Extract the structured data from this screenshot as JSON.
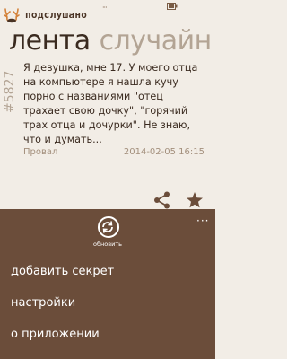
{
  "brand": {
    "logo_text": "подслушано",
    "icon": "antler-icon"
  },
  "pivot": {
    "active": "лента",
    "next": "случайн"
  },
  "post": {
    "id": "#5827",
    "text": "Я девушка, мне 17. У моего отца на компьютере я нашла кучу порно с названиями \"отец трахает свою дочку\", \"горячий трах отца и дочурки\". Не знаю, что и думать...",
    "category": "Провал",
    "date": "2014-02-05 16:15"
  },
  "actions": {
    "share_icon": "share-icon",
    "favorite_icon": "star-icon"
  },
  "appbar": {
    "refresh_label": "обновить",
    "menu": [
      {
        "label": "добавить секрет"
      },
      {
        "label": "настройки"
      },
      {
        "label": "о приложении"
      }
    ]
  },
  "colors": {
    "background": "#f2ede6",
    "appbar": "#6b4d3a",
    "text": "#3a2a1f",
    "muted": "#b3a494",
    "accent": "#7a5c45"
  }
}
